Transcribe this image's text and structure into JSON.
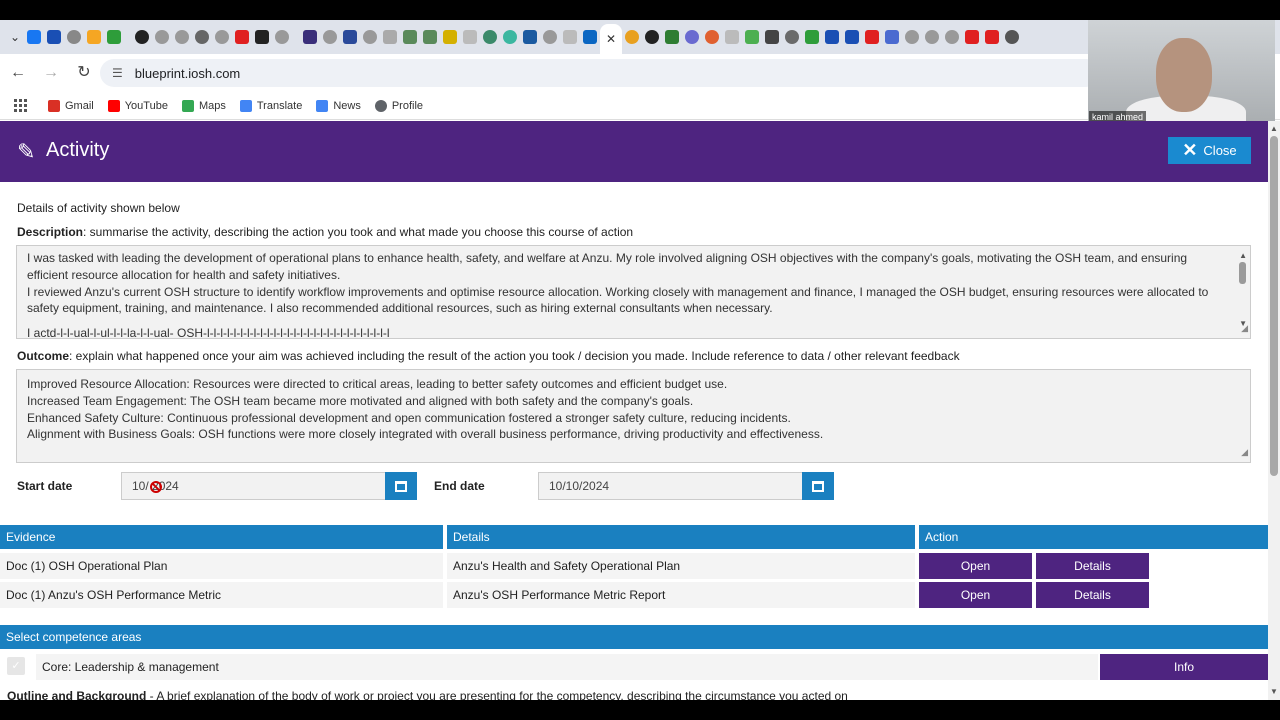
{
  "browser": {
    "url": "blueprint.iosh.com",
    "bookmarks": [
      {
        "label": "Gmail",
        "icon": "gmail-icon",
        "color": "#d93025"
      },
      {
        "label": "YouTube",
        "icon": "youtube-icon",
        "color": "#ff0000"
      },
      {
        "label": "Maps",
        "icon": "maps-icon",
        "color": "#34a853"
      },
      {
        "label": "Translate",
        "icon": "translate-icon",
        "color": "#4285f4"
      },
      {
        "label": "News",
        "icon": "news-icon",
        "color": "#4285f4"
      },
      {
        "label": "Profile",
        "icon": "profile-icon",
        "color": "#5f6368"
      }
    ],
    "active_tab_close": "✕"
  },
  "webcam": {
    "name": "kamil ahmed"
  },
  "modal": {
    "title": "Activity",
    "close_label": "Close",
    "intro": "Details of activity shown below",
    "description_label": "Description",
    "description_hint": ": summarise the activity, describing the action you took and what made you choose this course of action",
    "description_lines": [
      "I was tasked with leading the development of operational plans to enhance health, safety, and welfare at Anzu. My role involved aligning OSH objectives with the company's goals, motivating the OSH team, and ensuring efficient resource allocation for health and safety initiatives.",
      "I reviewed Anzu's current OSH structure to identify workflow improvements and optimise resource allocation. Working closely with management and finance, I managed the OSH budget, ensuring resources were allocated to safety equipment, training, and maintenance. I also recommended additional resources, such as hiring external consultants when necessary.",
      "I actd-l-l-ual-l-ul-l-l-la-l-l-ual- OSH-l-l-l-l-l-l-l-l-l-l-l-l-l-l-l-l-l-l-l-l-l-l-l-l-l-l-l-l"
    ],
    "outcome_label": "Outcome",
    "outcome_hint": ": explain what happened once your aim was achieved including the result of the action you took / decision you made. Include reference to data / other relevant feedback",
    "outcome_lines": [
      "Improved Resource Allocation: Resources were directed to critical areas, leading to better safety outcomes and efficient budget use.",
      "Increased Team Engagement: The OSH team became more motivated and aligned with both safety and the company's goals.",
      "Enhanced Safety Culture: Continuous professional development and open communication fostered a stronger safety culture, reducing incidents.",
      "Alignment with Business Goals: OSH functions were more closely integrated with overall business performance, driving productivity and effectiveness."
    ],
    "start_date_label": "Start date",
    "start_date_value": "10/ 2024",
    "end_date_label": "End date",
    "end_date_value": "10/10/2024",
    "evidence": {
      "headers": [
        "Evidence",
        "Details",
        "Action"
      ],
      "rows": [
        {
          "evidence": "Doc (1) OSH Operational Plan",
          "details": "Anzu's Health and Safety Operational Plan",
          "open": "Open",
          "details_btn": "Details"
        },
        {
          "evidence": "Doc (1) Anzu's OSH Performance Metric",
          "details": "Anzu's OSH Performance Metric Report",
          "open": "Open",
          "details_btn": "Details"
        }
      ]
    },
    "competence": {
      "header": "Select competence areas",
      "item": "Core: Leadership & management",
      "info_label": "Info",
      "check": "✓"
    },
    "outline_label": "Outline and Background",
    "outline_hint": " - A brief explanation of the body of work or project you are presenting for the competency, describing the circumstance you acted on"
  }
}
